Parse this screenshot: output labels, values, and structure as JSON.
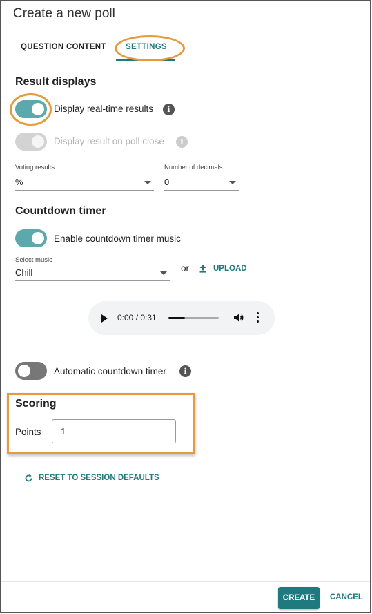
{
  "dialog": {
    "title": "Create a new poll"
  },
  "tabs": [
    {
      "label": "QUESTION CONTENT",
      "active": false
    },
    {
      "label": "SETTINGS",
      "active": true
    }
  ],
  "result_displays": {
    "title": "Result displays",
    "realtime": {
      "label": "Display real-time results",
      "on": true
    },
    "on_close": {
      "label": "Display result on poll close",
      "on": true,
      "disabled": true
    },
    "voting_results": {
      "label": "Voting results",
      "value": "%"
    },
    "decimals": {
      "label": "Number of decimals",
      "value": "0"
    }
  },
  "countdown": {
    "title": "Countdown timer",
    "music_toggle": {
      "label": "Enable countdown timer music",
      "on": true
    },
    "select_music": {
      "label": "Select music",
      "value": "Chill"
    },
    "or_text": "or",
    "upload_label": "UPLOAD",
    "audio": {
      "time": "0:00 / 0:31",
      "progress": 0.33
    },
    "auto_timer": {
      "label": "Automatic countdown timer",
      "on": false
    }
  },
  "scoring": {
    "title": "Scoring",
    "points_label": "Points",
    "points_value": "1"
  },
  "reset_label": "RESET TO SESSION DEFAULTS",
  "footer": {
    "create_label": "CREATE",
    "cancel_label": "CANCEL"
  },
  "colors": {
    "accent": "#1e7a7e",
    "toggle_on": "#5ba8ad",
    "annotation": "#e79a3c"
  },
  "icons": {
    "info": "info-icon",
    "upload": "upload-arrow-icon",
    "reset": "refresh-icon",
    "play": "play-icon",
    "volume": "volume-icon",
    "more": "more-vertical-icon"
  }
}
